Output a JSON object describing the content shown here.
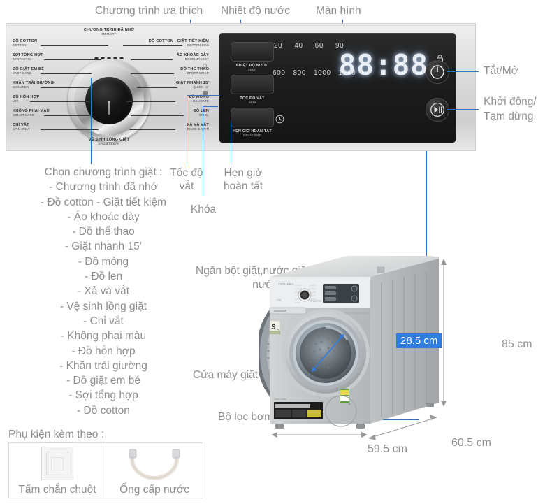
{
  "accent_color": "#2f74c0",
  "badge_color": "#2f7de1",
  "text_color": "#8f8f8f",
  "top_callouts": {
    "favorite_program": "Chương trình ưa thích",
    "water_temperature": "Nhiệt độ nước",
    "display": "Màn hình"
  },
  "right_callouts": {
    "power": "Tắt/Mở",
    "start_pause_line1": "Khởi động/",
    "start_pause_line2": "Tạm dừng"
  },
  "bottom_callouts": {
    "spin_speed_line1": "Tốc độ",
    "spin_speed_line2": "vắt",
    "delay_end_line1": "Hẹn giờ",
    "delay_end_line2": "hoàn tất",
    "lock": "Khóa"
  },
  "machine_callouts": {
    "detergent_drawer_line1": "Ngăn bột giặt,nước giặt/",
    "detergent_drawer_line2": "nước xả",
    "door": "Cửa máy giặt",
    "drain_filter": "Bộ lọc bơm xả"
  },
  "dial": {
    "memory": {
      "vi": "CHƯƠNG TRÌNH ĐÃ NHỚ",
      "en": "MEMORY"
    },
    "bottom": {
      "vi": "VỆ SINH LỒNG GIẶT",
      "en": "DRUM CLEAN"
    },
    "left_programs": [
      {
        "vi": "ĐỒ COTTON",
        "en": "COTTON"
      },
      {
        "vi": "SỢI TỔNG HỢP",
        "en": "SYNTHETIC"
      },
      {
        "vi": "ĐỒ GIẶT EM BÉ",
        "en": "BABY CARE"
      },
      {
        "vi": "KHĂN TRẢI GIƯỜNG",
        "en": "BEDLINEN"
      },
      {
        "vi": "ĐỒ HỖN HỢP",
        "en": "MIX"
      },
      {
        "vi": "KHÔNG PHAI MÀU",
        "en": "COLOR CARE"
      },
      {
        "vi": "CHỈ VẮT",
        "en": "SPIN ONLY"
      }
    ],
    "right_programs": [
      {
        "vi": "ĐỒ COTTON - GIẶT TIẾT KIỆM",
        "en": "COTTON ECO"
      },
      {
        "vi": "ÁO KHOÁC DÀY",
        "en": "DOWN JACKET"
      },
      {
        "vi": "ĐỒ THỂ THAO",
        "en": "SPORT WEAR"
      },
      {
        "vi": "GIẶT NHANH 15'",
        "en": "QUICK 15'"
      },
      {
        "vi": "ĐỒ MỎNG",
        "en": "DELICATE"
      },
      {
        "vi": "ĐỒ LEN",
        "en": "WOOL"
      },
      {
        "vi": "XẢ VÀ VẮT",
        "en": "RINSE & SPIN"
      }
    ]
  },
  "panel_buttons": [
    {
      "vi": "NHIỆT ĐỘ NƯỚC",
      "en": "TEMP"
    },
    {
      "vi": "TỐC ĐỘ VẮT",
      "en": "SPIN"
    },
    {
      "vi": "HẸN GIỜ HOÀN TẤT",
      "en": "DELAY END"
    }
  ],
  "display": {
    "temperatures": [
      "20",
      "40",
      "60",
      "90"
    ],
    "spin_speeds": [
      "600",
      "800",
      "1000",
      "1200"
    ],
    "readout": "88:88"
  },
  "program_list": {
    "title": "Chọn chương trình giặt :",
    "items": [
      "- Chương trình đã nhớ",
      "- Đồ cotton - Giặt tiết kiệm",
      "- Áo khoác dày",
      "- Đồ thể thao",
      "- Giặt nhanh 15’",
      "- Đồ mỏng",
      "- Đồ len",
      "- Xả và vắt",
      "- Vệ sinh lồng giặt",
      "- Chỉ vắt",
      "- Không phai màu",
      "- Đồ hỗn hợp",
      "- Khăn trải giường",
      "- Đồ giặt em bé",
      "- Sợi tổng hợp",
      "- Đồ cotton"
    ]
  },
  "accessories": {
    "title": "Phụ kiện kèm theo :",
    "items": [
      {
        "label": "Tấm chắn chuột"
      },
      {
        "label": "Ống cấp nước"
      }
    ]
  },
  "dimensions": {
    "drum_depth": "28.5 cm",
    "height": "85 cm",
    "width": "59.5 cm",
    "depth": "60.5 cm"
  },
  "machine": {
    "capacity_badge": "9",
    "capacity_unit": "kg"
  }
}
